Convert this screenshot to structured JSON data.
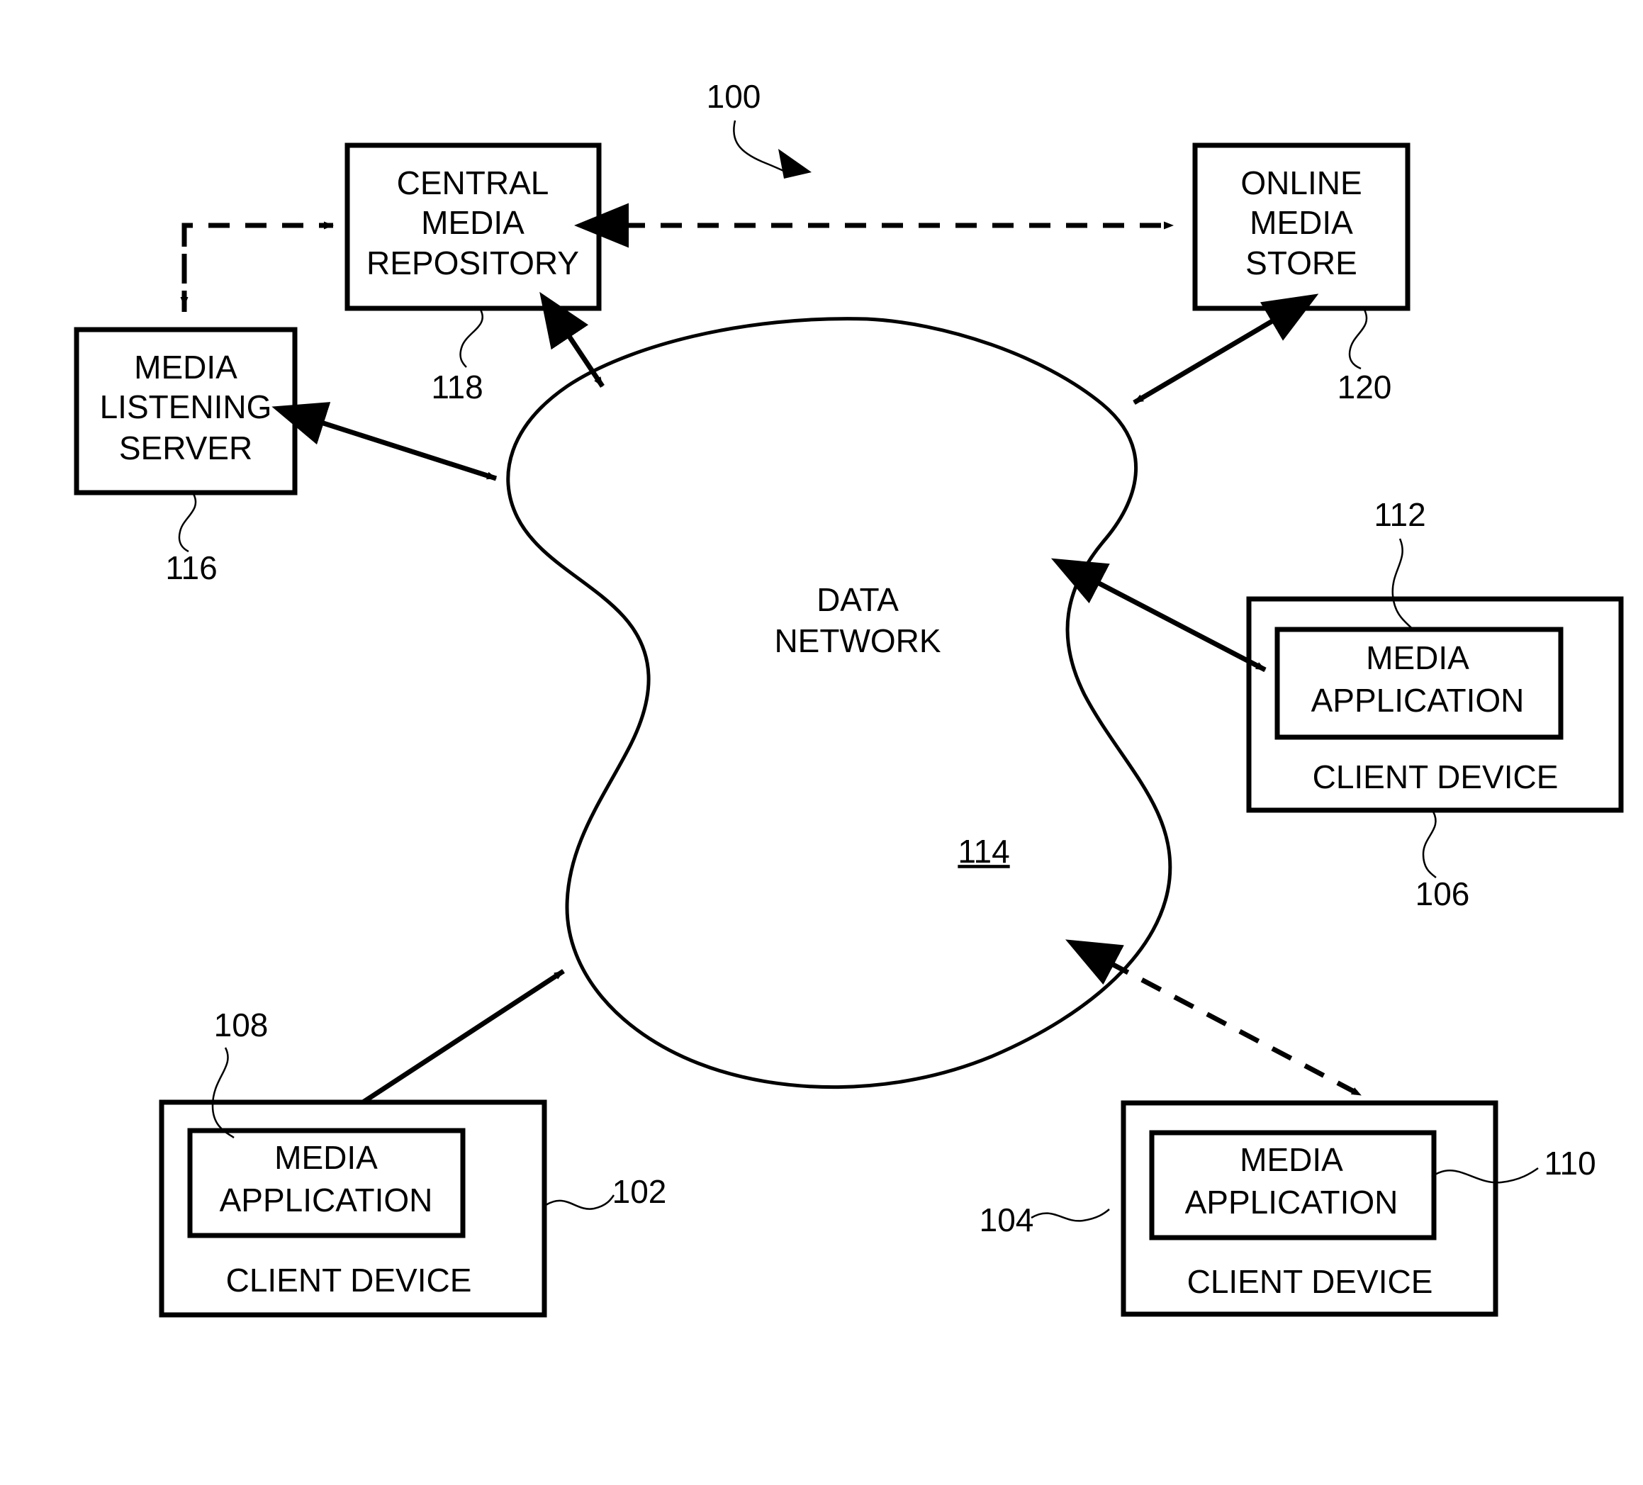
{
  "figure": {
    "system_ref": "100",
    "nodes": {
      "central_media_repository": {
        "lines": [
          "CENTRAL",
          "MEDIA",
          "REPOSITORY"
        ],
        "ref": "118"
      },
      "online_media_store": {
        "lines": [
          "ONLINE",
          "MEDIA",
          "STORE"
        ],
        "ref": "120"
      },
      "media_listening_server": {
        "lines": [
          "MEDIA",
          "LISTENING",
          "SERVER"
        ],
        "ref": "116"
      },
      "data_network": {
        "lines": [
          "DATA",
          "NETWORK"
        ],
        "ref": "114"
      },
      "client_device_left": {
        "app_lines": [
          "MEDIA",
          "APPLICATION"
        ],
        "device_label": "CLIENT DEVICE",
        "app_ref": "108",
        "device_ref": "102"
      },
      "client_device_right_top": {
        "app_lines": [
          "MEDIA",
          "APPLICATION"
        ],
        "device_label": "CLIENT DEVICE",
        "app_ref": "112",
        "device_ref": "106"
      },
      "client_device_bottom_right": {
        "app_lines": [
          "MEDIA",
          "APPLICATION"
        ],
        "device_label": "CLIENT DEVICE",
        "app_ref": "110",
        "device_ref": "104"
      }
    },
    "colors": {
      "stroke": "#000000",
      "background": "#ffffff"
    }
  }
}
